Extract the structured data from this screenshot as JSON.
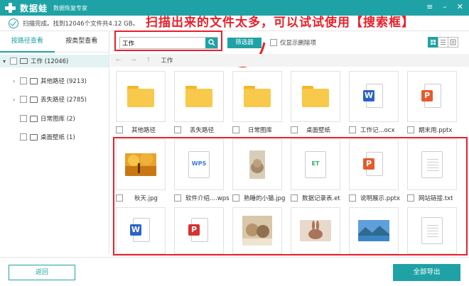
{
  "titlebar": {
    "app_name": "数据蛙",
    "subtitle": "数据恢复专家",
    "buttons": [
      "≡",
      "–",
      "✕"
    ]
  },
  "status": {
    "text": "扫描完成。找到12046个文件共4.12 GB。"
  },
  "annotation": "扫描出来的文件太多，可以试试使用【搜索框】",
  "sidebar": {
    "tabs": [
      "按路径查看",
      "按类型查看"
    ],
    "root": {
      "label": "工作 (12046)"
    },
    "items": [
      {
        "label": "其他路径 (9213)"
      },
      {
        "label": "丢失路径 (2785)"
      },
      {
        "label": "日常图库 (2)"
      },
      {
        "label": "桌面壁纸 (1)"
      }
    ]
  },
  "toolbar": {
    "search_value": "工作",
    "filter_label": "筛选器",
    "only_deleted_label": "仅显示删除项"
  },
  "breadcrumb": {
    "back": "←",
    "forward": "→",
    "up": "↑",
    "path": "工作"
  },
  "files": {
    "row1": [
      {
        "name": "其他路径",
        "icon": "folder-icon"
      },
      {
        "name": "丢失路径",
        "icon": "folder-icon"
      },
      {
        "name": "日常图库",
        "icon": "folder-icon"
      },
      {
        "name": "桌面壁纸",
        "icon": "folder-icon"
      },
      {
        "name": "工作记...ocx",
        "icon": "word-file-icon",
        "badge": "W"
      },
      {
        "name": "期末用.pptx",
        "icon": "ppt-file-icon",
        "badge": "P"
      }
    ],
    "row2": [
      {
        "name": "秋天.jpg",
        "icon": "autumn-photo-thumbnail"
      },
      {
        "name": "软件介绍....wps",
        "icon": "wps-file-icon",
        "tag": "WPS"
      },
      {
        "name": "熟睡的小猫.jpg",
        "icon": "cat-photo-thumbnail"
      },
      {
        "name": "数据记录表.et",
        "icon": "et-file-icon",
        "tag": "ET"
      },
      {
        "name": "说明展示.pptx",
        "icon": "ppt-file-icon",
        "badge": "P"
      },
      {
        "name": "网站链接.txt",
        "icon": "txt-file-icon"
      }
    ],
    "row3": [
      {
        "icon": "word-file-icon",
        "badge": "W"
      },
      {
        "icon": "pdf-file-icon",
        "badge": "P"
      },
      {
        "icon": "kittens-photo-thumbnail"
      },
      {
        "icon": "rabbit-photo-thumbnail"
      },
      {
        "icon": "lake-photo-thumbnail"
      },
      {
        "icon": "txt-file-icon"
      }
    ]
  },
  "bottom": {
    "back_label": "返回",
    "export_label": "全部导出"
  },
  "colors": {
    "accent": "#1fa2a5",
    "annotation": "#e8202a"
  }
}
